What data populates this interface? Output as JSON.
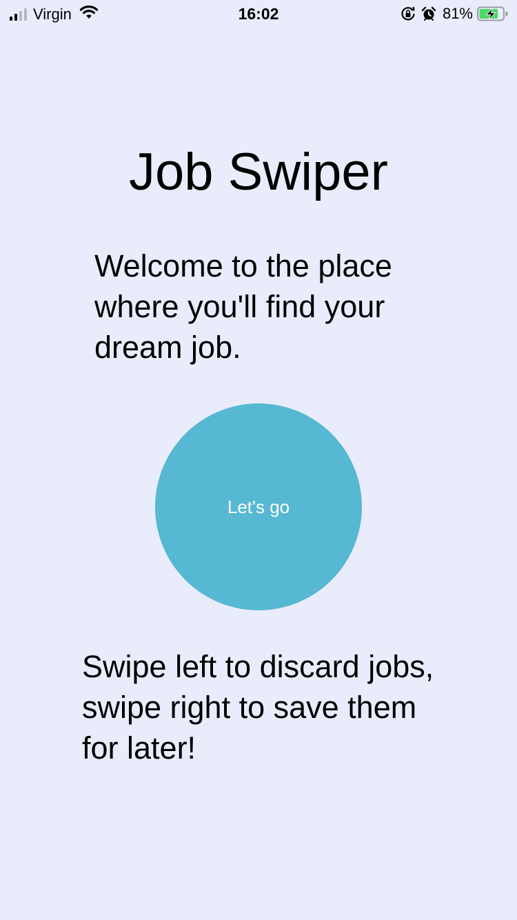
{
  "status_bar": {
    "carrier": "Virgin",
    "time": "16:02",
    "battery_percent": "81%",
    "signal_bars_active": 2,
    "signal_bars_total": 4,
    "battery_level": 0.81,
    "battery_charging": true,
    "icons": [
      "signal-icon",
      "wifi-icon",
      "orientation-lock-icon",
      "alarm-icon",
      "battery-charging-icon"
    ]
  },
  "main": {
    "title": "Job Swiper",
    "welcome": "Welcome to the place where you'll find your dream job.",
    "start_button_label": "Let's go",
    "instructions": "Swipe left to discard jobs, swipe right to save them for later!"
  },
  "colors": {
    "background": "#e9ecfb",
    "button": "#56b8d2",
    "button_text": "#ffffff",
    "battery_fill": "#4cd964"
  }
}
